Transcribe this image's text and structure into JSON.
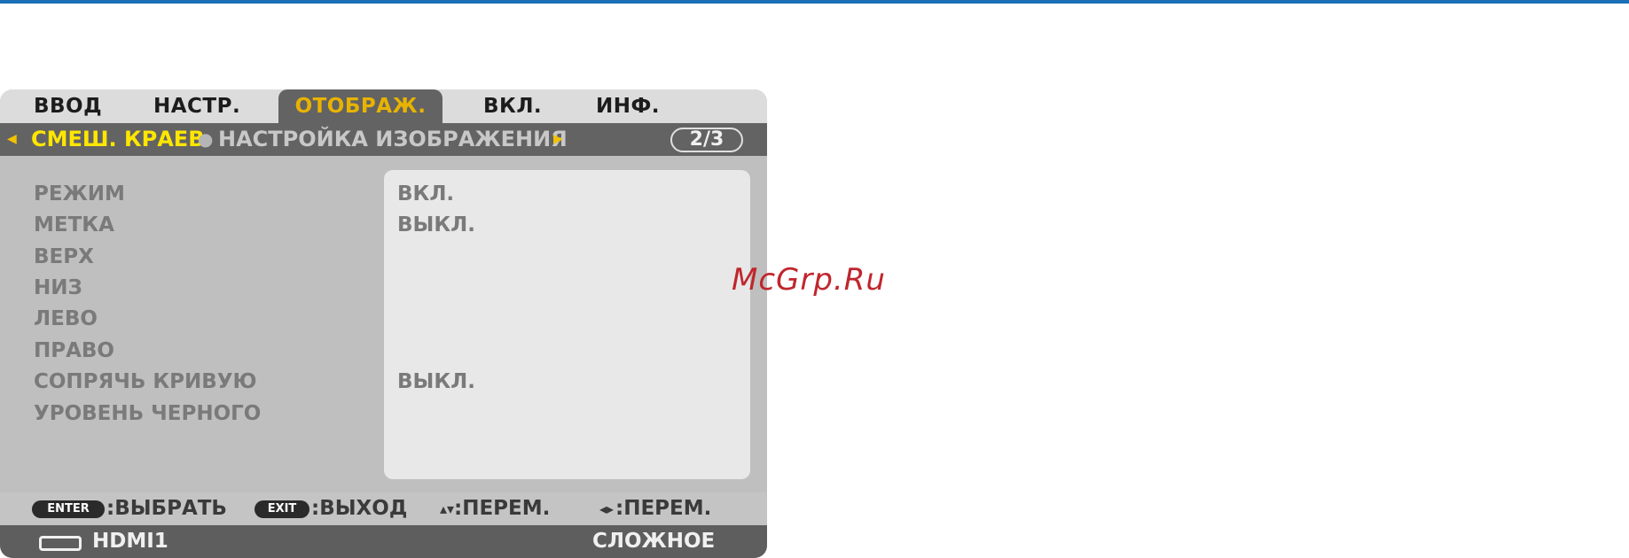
{
  "tabs": [
    {
      "label": "ВВОД",
      "active": false
    },
    {
      "label": "НАСТР.",
      "active": false
    },
    {
      "label": "ОТОБРАЖ.",
      "active": true
    },
    {
      "label": "ВКЛ.",
      "active": false
    },
    {
      "label": "ИНФ.",
      "active": false
    }
  ],
  "submenu": {
    "current": "СМЕШ. КРАЕВ",
    "next": "НАСТРОЙКА ИЗОБРАЖЕНИЯ",
    "page": "2/3",
    "left_arrow_icon": "triangle-left",
    "right_arrow_icon": "triangle-right"
  },
  "settings": [
    {
      "label": "РЕЖИМ",
      "value": "ВКЛ."
    },
    {
      "label": "МЕТКА",
      "value": "ВЫКЛ."
    },
    {
      "label": "ВЕРХ",
      "value": ""
    },
    {
      "label": "НИЗ",
      "value": ""
    },
    {
      "label": "ЛЕВО",
      "value": ""
    },
    {
      "label": "ПРАВО",
      "value": ""
    },
    {
      "label": "СОПРЯЧЬ КРИВУЮ",
      "value": "ВЫКЛ."
    },
    {
      "label": "УРОВЕНЬ ЧЕРНОГО",
      "value": ""
    }
  ],
  "hints": {
    "enter_key": "ENTER",
    "enter_action": ":ВЫБРАТЬ",
    "exit_key": "EXIT",
    "exit_action": ":ВЫХОД",
    "updown_action": ":ПЕРЕМ.",
    "leftright_action": ":ПЕРЕМ."
  },
  "status": {
    "source": "HDMI1",
    "mode": "СЛОЖНОЕ"
  },
  "watermark": "McGrp.Ru",
  "colors": {
    "accent_blue": "#1a6fb6",
    "active_tab_text": "#e8b300",
    "current_submenu": "#ffe600",
    "watermark": "#c0262d"
  }
}
